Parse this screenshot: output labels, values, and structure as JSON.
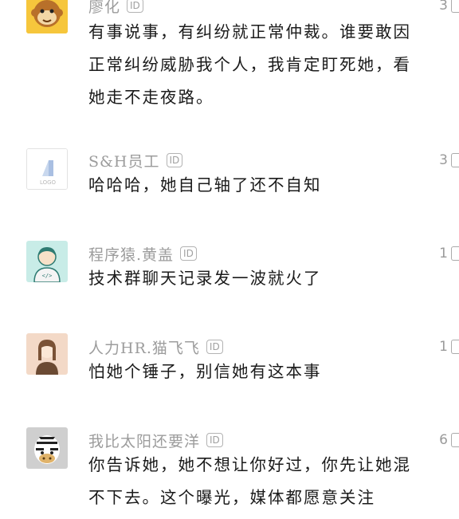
{
  "id_badge_label": "ID",
  "comments": [
    {
      "username": "廖化",
      "text": "有事说事，有纠纷就正常仲裁。谁要敢因正常纠纷威胁我个人，我肯定盯死她，看她走不走夜路。",
      "likes": "3",
      "avatar_icon": "monkey-avatar-icon"
    },
    {
      "username": "S&H员工",
      "text": "哈哈哈，她自己轴了还不自知",
      "likes": "3",
      "avatar_icon": "logo-avatar-icon"
    },
    {
      "username": "程序猿.黄盖",
      "text": "技术群聊天记录发一波就火了",
      "likes": "1",
      "avatar_icon": "programmer-avatar-icon"
    },
    {
      "username": "人力HR.猫飞飞",
      "text": "怕她个锤子，别信她有这本事",
      "likes": "1",
      "avatar_icon": "hr-avatar-icon"
    },
    {
      "username": "我比太阳还要洋",
      "text": "你告诉她，她不想让你好过，你先让她混不下去。这个曝光，媒体都愿意关注",
      "likes": "6",
      "avatar_icon": "zebra-avatar-icon"
    }
  ]
}
